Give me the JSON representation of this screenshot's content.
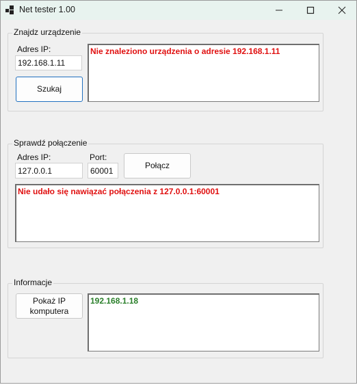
{
  "window": {
    "title": "Net tester 1.00",
    "icon": "app-window-icon"
  },
  "controls": {
    "minimize": "minimize-icon",
    "maximize": "maximize-icon",
    "close": "close-icon"
  },
  "find_device": {
    "group_label": "Znajdz urządzenie",
    "ip_label": "Adres IP:",
    "ip_value": "192.168.1.11",
    "search_button": "Szukaj",
    "result_text": "Nie znaleziono urządzenia o adresie 192.168.1.11"
  },
  "check_connection": {
    "group_label": "Sprawdź połączenie",
    "ip_label": "Adres IP:",
    "ip_value": "127.0.0.1",
    "port_label": "Port:",
    "port_value": "60001",
    "connect_button": "Połącz",
    "result_text": "Nie udało się nawiązać połączenia z 127.0.0.1:60001"
  },
  "info": {
    "group_label": "Informacje",
    "show_ip_button_line1": "Pokaż IP",
    "show_ip_button_line2": "komputera",
    "result_text": "192.168.1.18"
  },
  "colors": {
    "error": "#e01010",
    "success": "#2a7f2a",
    "focus": "#1f6fbf",
    "titlebar": "#e8f3ef"
  }
}
